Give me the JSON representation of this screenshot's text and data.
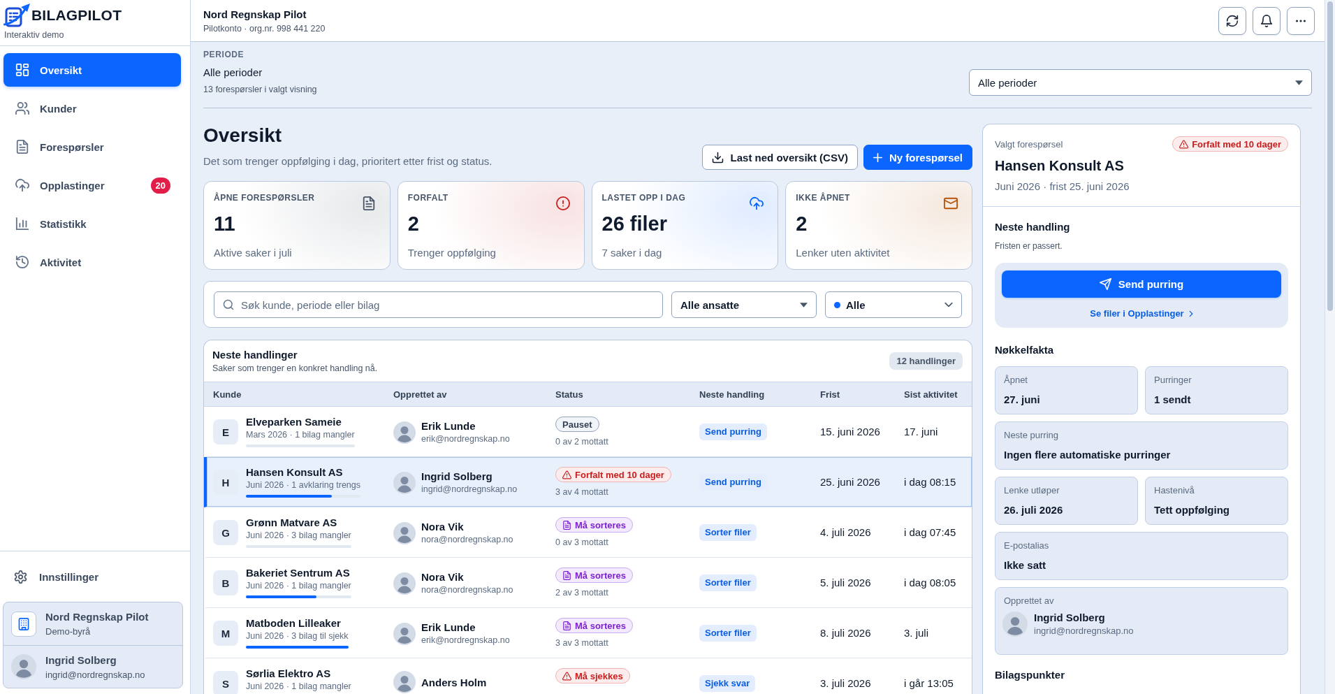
{
  "sidebar": {
    "brand": "BILAGPILOT",
    "tagline": "Interaktiv demo",
    "nav": [
      {
        "label": "Oversikt",
        "selected": true
      },
      {
        "label": "Kunder",
        "selected": false
      },
      {
        "label": "Forespørsler",
        "selected": false
      },
      {
        "label": "Opplastinger",
        "selected": false,
        "badge": "20"
      },
      {
        "label": "Statistikk",
        "selected": false
      },
      {
        "label": "Aktivitet",
        "selected": false
      }
    ],
    "settings": "Innstillinger",
    "organization": {
      "name": "Nord Regnskap Pilot",
      "subtitle": "Demo-byrå"
    },
    "user": {
      "name": "Ingrid Solberg",
      "email": "ingrid@nordregnskap.no"
    }
  },
  "header": {
    "title": "Nord Regnskap Pilot",
    "subtitle": "Pilotkonto · org.nr. 998 441 220"
  },
  "period": {
    "label": "PERIODE",
    "value": "Alle perioder",
    "count": "13 forespørsler i valgt visning",
    "select": "Alle perioder"
  },
  "overview": {
    "title": "Oversikt",
    "subtitle": "Det som trenger oppfølging i dag, prioritert etter frist og status.",
    "buttons": [
      {
        "label": "Last ned oversikt (CSV)",
        "kind": "secondary"
      },
      {
        "label": "Ny forespørsel",
        "kind": "primary"
      }
    ]
  },
  "stats": [
    {
      "label": "ÅPNE FORESPØRSLER",
      "value": "11",
      "caption": "Aktive saker i juli",
      "color": "#475569"
    },
    {
      "label": "FORFALT",
      "value": "2",
      "caption": "Trenger oppfølging",
      "color": "#c81e1e"
    },
    {
      "label": "LASTET OPP I DAG",
      "value": "26 filer",
      "caption": "7 saker i dag",
      "color": "#0a66ff"
    },
    {
      "label": "IKKE ÅPNET",
      "value": "2",
      "caption": "Lenker uten aktivitet",
      "color": "#b45309"
    }
  ],
  "filters": {
    "search": {
      "placeholder": "Søk kunde, periode eller bilag"
    },
    "employee": "Alle ansatte",
    "status": "Alle"
  },
  "table": {
    "title": "Neste handlinger",
    "subtitle": "Saker som trenger en konkret handling nå.",
    "count": "12 handlinger",
    "columns": [
      "Kunde",
      "Opprettet av",
      "Status",
      "Neste handling",
      "Frist",
      "Sist aktivitet"
    ],
    "rows": [
      {
        "initial": "E",
        "name": "Elveparken Sameie",
        "detail": "Mars 2026 · 1 bilag mangler",
        "level": 0,
        "creator": {
          "name": "Erik Lunde",
          "email": "erik@nordregnskap.no"
        },
        "status": {
          "kind": "paused",
          "label": "Pauset"
        },
        "received": "0 av 2 mottatt",
        "action": "Send purring",
        "due": "15. juni 2026",
        "last_activity": "17. juni",
        "selected": false
      },
      {
        "initial": "H",
        "name": "Hansen Konsult AS",
        "detail": "Juni 2026 · 1 avklaring trengs",
        "level": 0.75,
        "creator": {
          "name": "Ingrid Solberg",
          "email": "ingrid@nordregnskap.no"
        },
        "status": {
          "kind": "overdue",
          "label": "Forfalt med 10 dager"
        },
        "received": "3 av 4 mottatt",
        "action": "Send purring",
        "due": "25. juni 2026",
        "last_activity": "i dag 08:15",
        "selected": true
      },
      {
        "initial": "G",
        "name": "Grønn Matvare AS",
        "detail": "Juni 2026 · 3 bilag mangler",
        "level": 0,
        "creator": {
          "name": "Nora Vik",
          "email": "nora@nordregnskap.no"
        },
        "status": {
          "kind": "sort",
          "label": "Må sorteres"
        },
        "received": "0 av 3 mottatt",
        "action": "Sorter filer",
        "due": "4. juli 2026",
        "last_activity": "i dag 07:45",
        "selected": false
      },
      {
        "initial": "B",
        "name": "Bakeriet Sentrum AS",
        "detail": "Juni 2026 · 1 bilag mangler",
        "level": 0.67,
        "creator": {
          "name": "Nora Vik",
          "email": "nora@nordregnskap.no"
        },
        "status": {
          "kind": "sort",
          "label": "Må sorteres"
        },
        "received": "2 av 3 mottatt",
        "action": "Sorter filer",
        "due": "5. juli 2026",
        "last_activity": "i dag 08:05",
        "selected": false
      },
      {
        "initial": "M",
        "name": "Matboden Lilleaker",
        "detail": "Juni 2026 · 3 bilag til sjekk",
        "level": 1,
        "creator": {
          "name": "Erik Lunde",
          "email": "erik@nordregnskap.no"
        },
        "status": {
          "kind": "sort",
          "label": "Må sorteres"
        },
        "received": "3 av 3 mottatt",
        "action": "Sorter filer",
        "due": "8. juli 2026",
        "last_activity": "3. juli",
        "selected": false
      },
      {
        "initial": "S",
        "name": "Sørlia Elektro AS",
        "detail": "Juni 2026 · 1 bilag mangler",
        "creator": {
          "name": "Anders Holm"
        },
        "status": {
          "kind": "check",
          "label": "Må sjekkes"
        },
        "action": "Sjekk svar",
        "due": "3. juli 2026",
        "last_activity": "i går 13:05",
        "selected": false
      }
    ]
  },
  "detail": {
    "eyebrow": "Valgt forespørsel",
    "status": {
      "kind": "overdue",
      "label": "Forfalt med 10 dager"
    },
    "title": "Hansen Konsult AS",
    "subtitle": "Juni 2026 · frist 25. juni 2026",
    "next_action": {
      "title": "Neste handling",
      "note": "Fristen er passert.",
      "button": "Send purring",
      "link": "Se filer i Opplastinger"
    },
    "facts_title": "Nøkkelfakta",
    "facts": [
      {
        "label": "Åpnet",
        "value": "27. juni",
        "kind": "half"
      },
      {
        "label": "Purringer",
        "value": "1 sendt",
        "kind": "half"
      },
      {
        "label": "Neste purring",
        "value": "Ingen flere automatiske purringer",
        "kind": "full"
      },
      {
        "label": "Lenke utløper",
        "value": "26. juli 2026",
        "kind": "half"
      },
      {
        "label": "Hastenivå",
        "value": "Tett oppfølging",
        "kind": "half"
      },
      {
        "label": "E-postalias",
        "value": "Ikke satt",
        "kind": "full"
      }
    ],
    "created_by": {
      "label": "Opprettet av",
      "name": "Ingrid Solberg",
      "email": "ingrid@nordregnskap.no"
    },
    "items_title": "Bilagspunkter"
  }
}
